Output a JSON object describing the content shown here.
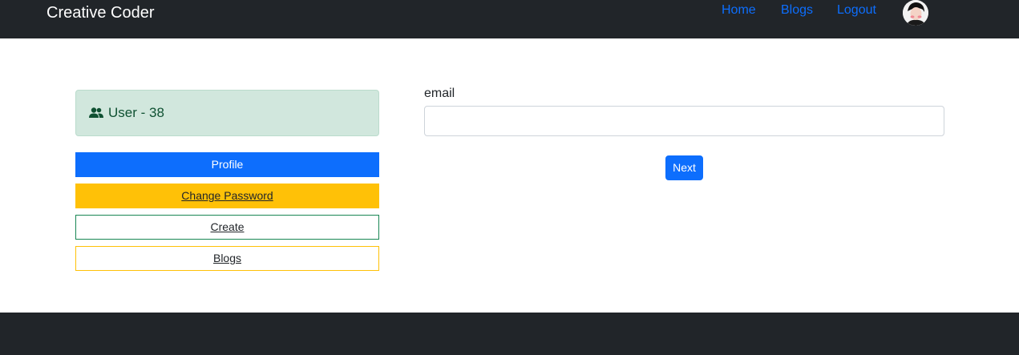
{
  "navbar": {
    "brand": "Creative Coder",
    "links": {
      "home": "Home",
      "blogs": "Blogs",
      "logout": "Logout"
    }
  },
  "sidebar": {
    "user_label": "User - 38",
    "buttons": {
      "profile": "Profile",
      "change_password": "Change Password",
      "create": "Create",
      "blogs": "Blogs"
    }
  },
  "form": {
    "email_label": "email",
    "email_value": "",
    "next_label": "Next"
  },
  "icons": {
    "user": "users-icon",
    "avatar": "user-avatar"
  },
  "colors": {
    "navbar_bg": "#212529",
    "primary": "#0d6efd",
    "warning": "#ffc107",
    "success": "#198754",
    "success_light": "#d1e7dd"
  }
}
